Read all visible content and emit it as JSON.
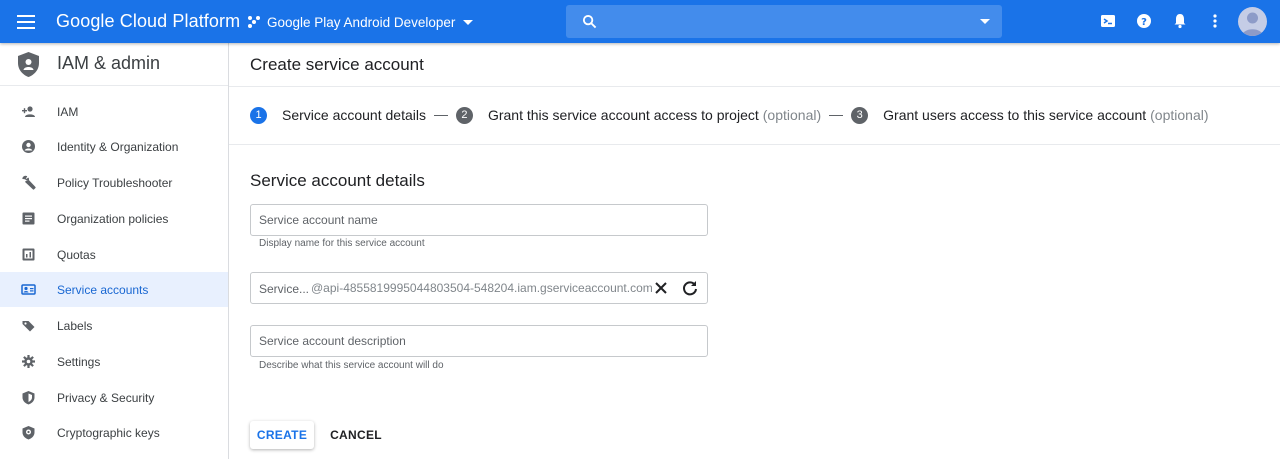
{
  "header": {
    "brand": "Google Cloud Platform",
    "project": "Google Play Android Developer",
    "search_placeholder": "",
    "accent_color": "#1a73e8"
  },
  "sidebar": {
    "title": "IAM & admin",
    "items": [
      {
        "label": "IAM",
        "icon": "person-add-icon",
        "active": false
      },
      {
        "label": "Identity & Organization",
        "icon": "account-circle-icon",
        "active": false
      },
      {
        "label": "Policy Troubleshooter",
        "icon": "wrench-icon",
        "active": false
      },
      {
        "label": "Organization policies",
        "icon": "list-doc-icon",
        "active": false
      },
      {
        "label": "Quotas",
        "icon": "quota-icon",
        "active": false
      },
      {
        "label": "Service accounts",
        "icon": "service-account-icon",
        "active": true
      },
      {
        "label": "Labels",
        "icon": "label-icon",
        "active": false
      },
      {
        "label": "Settings",
        "icon": "gear-icon",
        "active": false
      },
      {
        "label": "Privacy & Security",
        "icon": "shield-icon",
        "active": false
      },
      {
        "label": "Cryptographic keys",
        "icon": "key-shield-icon",
        "active": false
      }
    ]
  },
  "main": {
    "title": "Create service account",
    "steps": [
      {
        "num": "1",
        "label": "Service account details",
        "optional": ""
      },
      {
        "num": "2",
        "label": "Grant this service account access to project",
        "optional": "(optional)"
      },
      {
        "num": "3",
        "label": "Grant users access to this service account",
        "optional": "(optional)"
      }
    ],
    "section_title": "Service account details",
    "name_field": {
      "placeholder": "Service account name",
      "value": "",
      "hint": "Display name for this service account"
    },
    "id_field": {
      "label": "Service...",
      "suffix": "@api-4855819995044803504-548204.iam.gserviceaccount.com"
    },
    "desc_field": {
      "placeholder": "Service account description",
      "value": "",
      "hint": "Describe what this service account will do"
    },
    "create_label": "CREATE",
    "cancel_label": "CANCEL"
  }
}
